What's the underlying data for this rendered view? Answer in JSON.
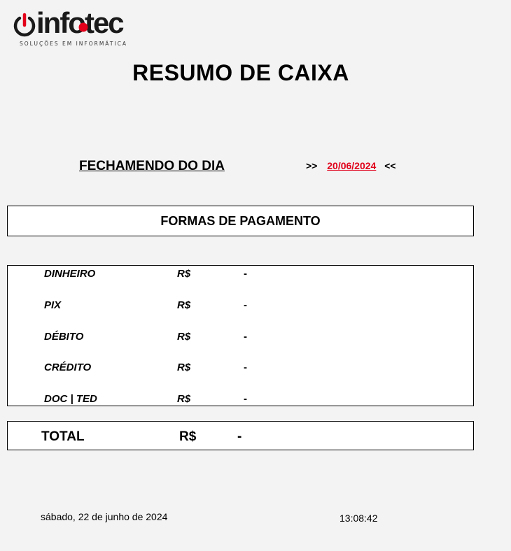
{
  "logo": {
    "brand": "infotec",
    "tagline": "SOLUÇÕES EM INFORMÁTICA",
    "icon": "power-icon",
    "accent_color": "#e2001a"
  },
  "header": {
    "title": "RESUMO DE CAIXA"
  },
  "closing": {
    "label": "FECHAMENDO DO DIA",
    "prefix": ">>",
    "date": "20/06/2024",
    "suffix": "<<",
    "date_color": "#e0001a"
  },
  "formas": {
    "title": "FORMAS DE PAGAMENTO"
  },
  "payments": [
    {
      "name": "DINHEIRO",
      "currency": "R$",
      "value": "-"
    },
    {
      "name": "PIX",
      "currency": "R$",
      "value": "-"
    },
    {
      "name": "DÉBITO",
      "currency": "R$",
      "value": "-"
    },
    {
      "name": "CRÉDITO",
      "currency": "R$",
      "value": "-"
    },
    {
      "name": "DOC | TED",
      "currency": "R$",
      "value": "-"
    }
  ],
  "total": {
    "label": "TOTAL",
    "currency": "R$",
    "value": "-"
  },
  "footer": {
    "date_text": "sábado, 22 de junho de 2024",
    "time": "13:08:42"
  }
}
